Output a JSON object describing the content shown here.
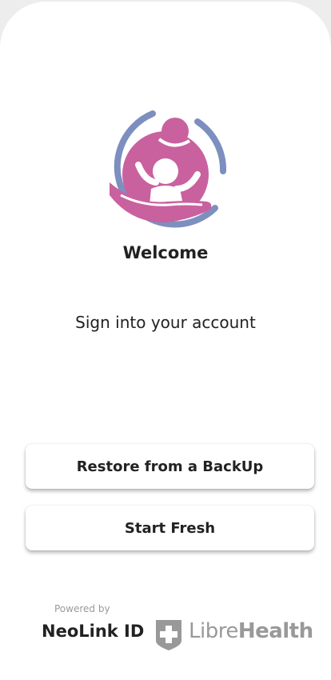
{
  "welcome": {
    "title": "Welcome",
    "subtitle": "Sign into your account"
  },
  "actions": {
    "restore_label": "Restore from a BackUp",
    "fresh_label": "Start Fresh"
  },
  "footer": {
    "powered_by": "Powered by",
    "product_name": "NeoLink ID",
    "partner_name_light": "Libre",
    "partner_name_bold": "Health"
  },
  "colors": {
    "logo_ring": "#7d8fbf",
    "logo_pink": "#c9619f",
    "text": "#222222",
    "muted": "#9a9a9a",
    "partner_gray": "#999999"
  },
  "icons": {
    "app_logo": "mother-and-child-logo",
    "partner_logo": "medical-cross-shield-icon"
  }
}
